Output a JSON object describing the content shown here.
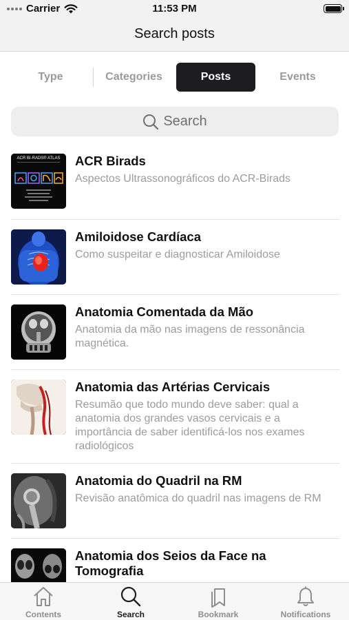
{
  "status_bar": {
    "carrier": "Carrier",
    "time": "11:53 PM"
  },
  "nav": {
    "title": "Search posts"
  },
  "segments": [
    {
      "label": "Type"
    },
    {
      "label": "Categories"
    },
    {
      "label": "Posts",
      "selected": true
    },
    {
      "label": "Events"
    }
  ],
  "search": {
    "placeholder": "Search"
  },
  "posts": [
    {
      "title": "ACR Birads",
      "description": "Aspectos Ultrassonográficos do ACR-Birads",
      "thumb_text": "ACR BI-RADS® ATLAS"
    },
    {
      "title": "Amiloidose Cardíaca",
      "description": "Como suspeitar e diagnosticar Amiloidose"
    },
    {
      "title": "Anatomia Comentada da Mão",
      "description": "Anatomia da mão nas imagens de ressonância magnética."
    },
    {
      "title": "Anatomia das Artérias Cervicais",
      "description": "Resumão que todo mundo deve saber: qual a anatomia dos grandes vasos cervicais e a importância de saber identificá-los nos exames radiológicos"
    },
    {
      "title": "Anatomia do Quadril na RM",
      "description": "Revisão anatômica do quadril nas imagens de RM"
    },
    {
      "title": "Anatomia dos Seios da Face na Tomografia",
      "description": ""
    }
  ],
  "tabs": [
    {
      "label": "Contents",
      "icon": "home-icon"
    },
    {
      "label": "Search",
      "icon": "search-icon",
      "active": true
    },
    {
      "label": "Bookmark",
      "icon": "bookmark-icon"
    },
    {
      "label": "Notifications",
      "icon": "bell-icon"
    }
  ],
  "colors": {
    "accent": "#1d1d1f",
    "muted_text": "#9c9c9c",
    "background": "#ffffff",
    "bar_background": "#f2f2f2"
  }
}
